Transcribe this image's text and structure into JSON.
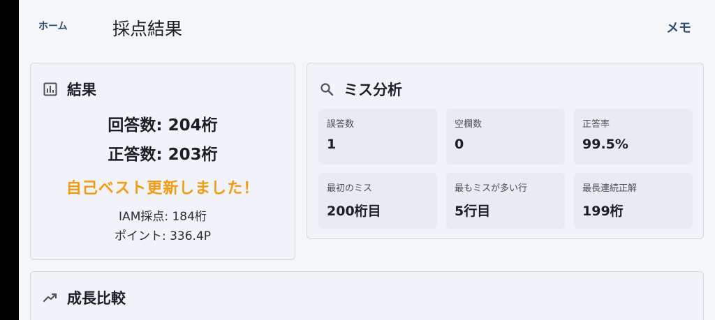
{
  "header": {
    "home_label": "ホーム",
    "title": "採点結果",
    "memo_label": "メモ"
  },
  "result": {
    "title": "結果",
    "answered": "回答数: 204桁",
    "correct": "正答数: 203桁",
    "best_message": "自己ベスト更新しました！",
    "iam_score": "IAM採点: 184桁",
    "points": "ポイント: 336.4P"
  },
  "miss_analysis": {
    "title": "ミス分析",
    "stats": [
      {
        "label": "誤答数",
        "value": "1"
      },
      {
        "label": "空欄数",
        "value": "0"
      },
      {
        "label": "正答率",
        "value": "99.5%"
      },
      {
        "label": "最初のミス",
        "value": "200桁目"
      },
      {
        "label": "最もミスが多い行",
        "value": "5行目"
      },
      {
        "label": "最長連続正解",
        "value": "199桁"
      }
    ]
  },
  "growth": {
    "title": "成長比較"
  },
  "colors": {
    "accent_best": "#f39c12",
    "link": "#2d4a67",
    "card_bg": "#f1f3f8",
    "stat_bg": "#e8ebf2"
  },
  "icons": {
    "result": "bar-chart-icon",
    "miss": "search-icon",
    "growth": "trending-up-icon"
  }
}
